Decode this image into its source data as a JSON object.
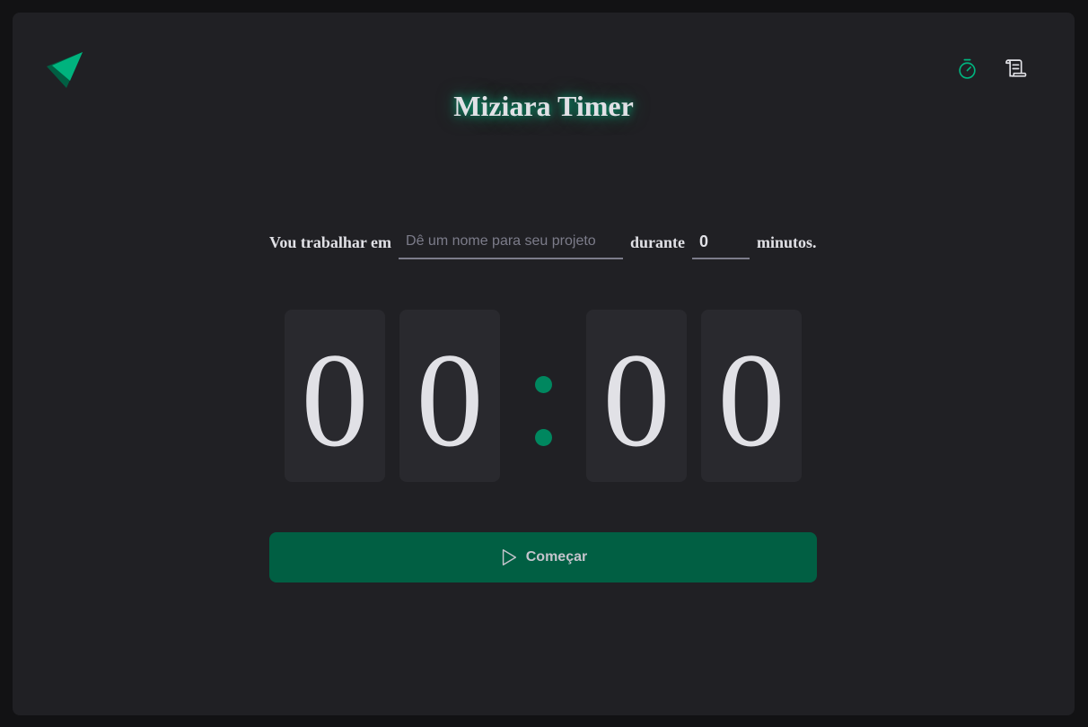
{
  "app": {
    "title": "Miziara Timer",
    "logo_icon": "triangle-logo-icon",
    "accent_color": "#00875f"
  },
  "nav": {
    "items": [
      {
        "icon": "timer-icon",
        "active": true,
        "color": "#00b37e"
      },
      {
        "icon": "scroll-history-icon",
        "active": false,
        "color": "#e1e1e6"
      }
    ]
  },
  "form": {
    "label_before": "Vou trabalhar em",
    "task_placeholder": "Dê um nome para seu projeto",
    "task_value": "",
    "label_middle": "durante",
    "minutes_value": "0",
    "label_after": "minutos."
  },
  "countdown": {
    "minutes_tens": "0",
    "minutes_ones": "0",
    "seconds_tens": "0",
    "seconds_ones": "0"
  },
  "start_button": {
    "label": "Começar",
    "icon": "play-icon",
    "color": "#015f43"
  }
}
